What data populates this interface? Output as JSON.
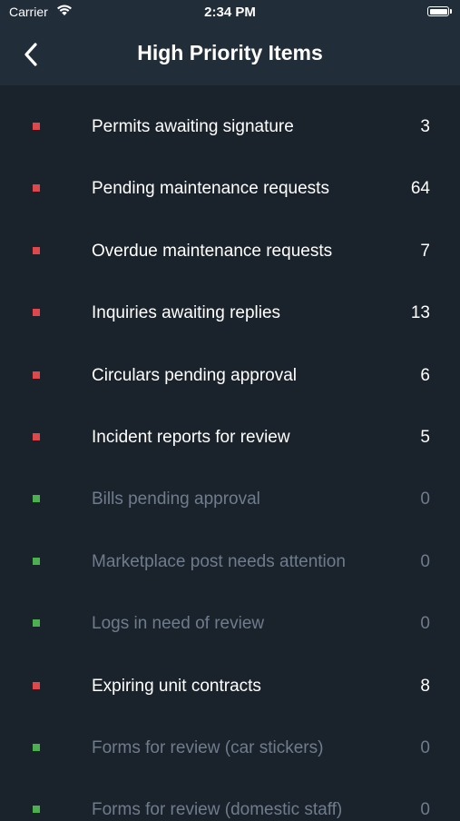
{
  "status_bar": {
    "carrier": "Carrier",
    "time": "2:34 PM"
  },
  "nav": {
    "title": "High Priority Items",
    "back_icon": "chevron-left-icon"
  },
  "colors": {
    "high": "#e0474c",
    "low": "#4caf50",
    "active_text": "#ffffff",
    "muted_text": "#6e7c8c"
  },
  "items": [
    {
      "label": "Permits awaiting signature",
      "count": "3",
      "priority": "high"
    },
    {
      "label": "Pending maintenance requests",
      "count": "64",
      "priority": "high"
    },
    {
      "label": "Overdue maintenance requests",
      "count": "7",
      "priority": "high"
    },
    {
      "label": "Inquiries awaiting replies",
      "count": "13",
      "priority": "high"
    },
    {
      "label": "Circulars pending approval",
      "count": "6",
      "priority": "high"
    },
    {
      "label": "Incident reports for review",
      "count": "5",
      "priority": "high"
    },
    {
      "label": "Bills pending approval",
      "count": "0",
      "priority": "low"
    },
    {
      "label": "Marketplace post needs attention",
      "count": "0",
      "priority": "low"
    },
    {
      "label": "Logs in need of review",
      "count": "0",
      "priority": "low"
    },
    {
      "label": "Expiring unit contracts",
      "count": "8",
      "priority": "high"
    },
    {
      "label": "Forms for review (car stickers)",
      "count": "0",
      "priority": "low"
    },
    {
      "label": "Forms for review (domestic staff)",
      "count": "0",
      "priority": "low"
    }
  ]
}
